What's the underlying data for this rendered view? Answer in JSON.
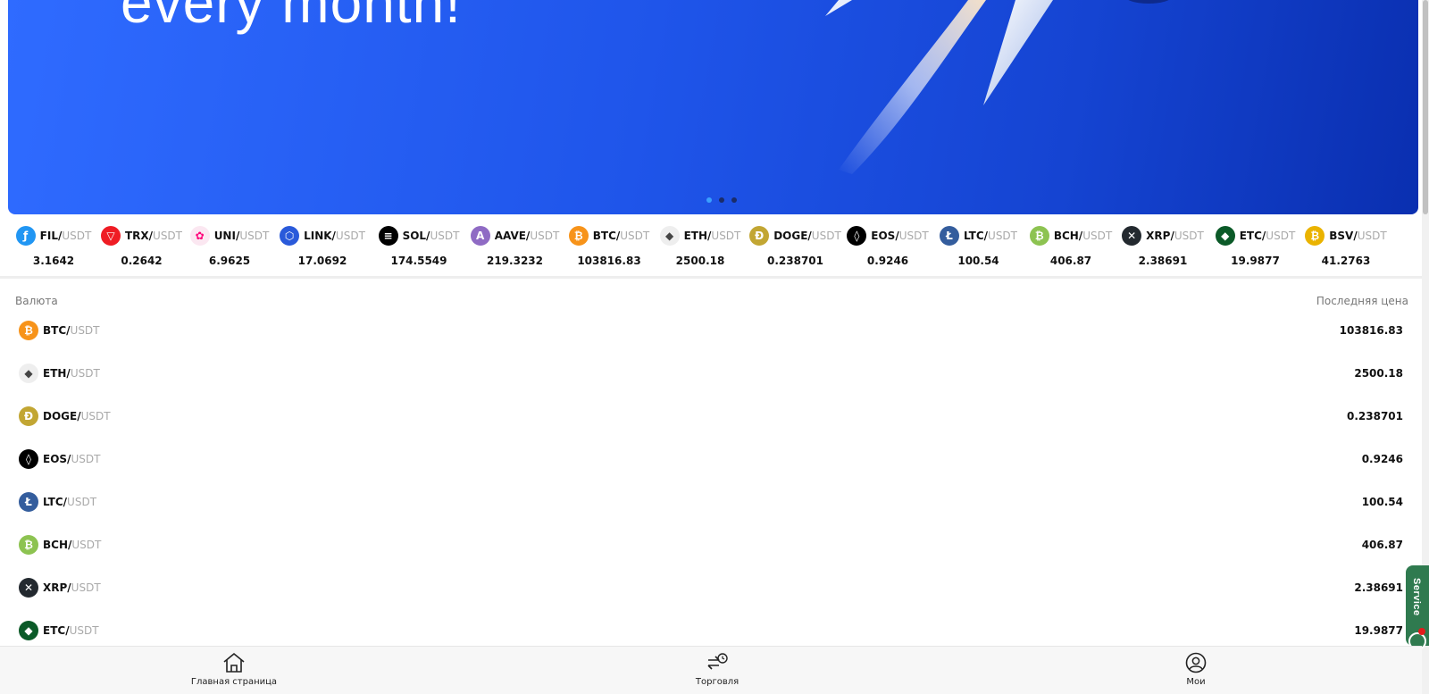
{
  "banner": {
    "headline": "every month!",
    "dots": 3,
    "active_dot": 0,
    "colors": {
      "from": "#2f6bff",
      "to": "#0a2fb0"
    }
  },
  "ticker": [
    {
      "base": "FIL/",
      "quote": "USDT",
      "price": "3.1642",
      "icon": "filecoin-icon",
      "color": "#2196f3",
      "glyph": "ƒ"
    },
    {
      "base": "TRX/",
      "quote": "USDT",
      "price": "0.2642",
      "icon": "tron-icon",
      "color": "#ef1c24",
      "glyph": "▽"
    },
    {
      "base": "UNI/",
      "quote": "USDT",
      "price": "6.9625",
      "icon": "uniswap-icon",
      "color": "#fbe7f1",
      "glyph": "✿"
    },
    {
      "base": "LINK/",
      "quote": "USDT",
      "price": "17.0692",
      "icon": "chainlink-icon",
      "color": "#2a5ada",
      "glyph": "⬡"
    },
    {
      "base": "SOL/",
      "quote": "USDT",
      "price": "174.5549",
      "icon": "solana-icon",
      "color": "#000000",
      "glyph": "≡"
    },
    {
      "base": "AAVE/",
      "quote": "USDT",
      "price": "219.3232",
      "icon": "aave-icon",
      "color": "#8f6bc4",
      "glyph": "A"
    },
    {
      "base": "BTC/",
      "quote": "USDT",
      "price": "103816.83",
      "icon": "bitcoin-icon",
      "color": "#f7931a",
      "glyph": "₿"
    },
    {
      "base": "ETH/",
      "quote": "USDT",
      "price": "2500.18",
      "icon": "ethereum-icon",
      "color": "#eeeeee",
      "glyph": "◆"
    },
    {
      "base": "DOGE/",
      "quote": "USDT",
      "price": "0.238701",
      "icon": "dogecoin-icon",
      "color": "#c2a633",
      "glyph": "Ð"
    },
    {
      "base": "EOS/",
      "quote": "USDT",
      "price": "0.9246",
      "icon": "eos-icon",
      "color": "#000000",
      "glyph": "◊"
    },
    {
      "base": "LTC/",
      "quote": "USDT",
      "price": "100.54",
      "icon": "litecoin-icon",
      "color": "#345d9d",
      "glyph": "Ł"
    },
    {
      "base": "BCH/",
      "quote": "USDT",
      "price": "406.87",
      "icon": "bitcoin-cash-icon",
      "color": "#8dc351",
      "glyph": "₿"
    },
    {
      "base": "XRP/",
      "quote": "USDT",
      "price": "2.38691",
      "icon": "xrp-icon",
      "color": "#23292f",
      "glyph": "✕"
    },
    {
      "base": "ETC/",
      "quote": "USDT",
      "price": "19.9877",
      "icon": "ethereum-classic-icon",
      "color": "#0b5a28",
      "glyph": "◆"
    },
    {
      "base": "BSV/",
      "quote": "USDT",
      "price": "41.2763",
      "icon": "bitcoin-sv-icon",
      "color": "#eab300",
      "glyph": "₿"
    }
  ],
  "list": {
    "col_currency": "Валюта",
    "col_last_price": "Последняя цена",
    "rows": [
      {
        "base": "BTC/",
        "quote": "USDT",
        "price": "103816.83",
        "icon": "bitcoin-icon",
        "color": "#f7931a",
        "glyph": "₿"
      },
      {
        "base": "ETH/",
        "quote": "USDT",
        "price": "2500.18",
        "icon": "ethereum-icon",
        "color": "#eeeeee",
        "glyph": "◆"
      },
      {
        "base": "DOGE/",
        "quote": "USDT",
        "price": "0.238701",
        "icon": "dogecoin-icon",
        "color": "#c2a633",
        "glyph": "Ð"
      },
      {
        "base": "EOS/",
        "quote": "USDT",
        "price": "0.9246",
        "icon": "eos-icon",
        "color": "#000000",
        "glyph": "◊"
      },
      {
        "base": "LTC/",
        "quote": "USDT",
        "price": "100.54",
        "icon": "litecoin-icon",
        "color": "#345d9d",
        "glyph": "Ł"
      },
      {
        "base": "BCH/",
        "quote": "USDT",
        "price": "406.87",
        "icon": "bitcoin-cash-icon",
        "color": "#8dc351",
        "glyph": "₿"
      },
      {
        "base": "XRP/",
        "quote": "USDT",
        "price": "2.38691",
        "icon": "xrp-icon",
        "color": "#23292f",
        "glyph": "✕"
      },
      {
        "base": "ETC/",
        "quote": "USDT",
        "price": "19.9877",
        "icon": "ethereum-classic-icon",
        "color": "#0b5a28",
        "glyph": "◆"
      }
    ]
  },
  "nav": {
    "home": "Главная страница",
    "trade": "Торговля",
    "mine": "Мои"
  },
  "service": {
    "label": "Service",
    "badge_color": "#e31b1b"
  }
}
